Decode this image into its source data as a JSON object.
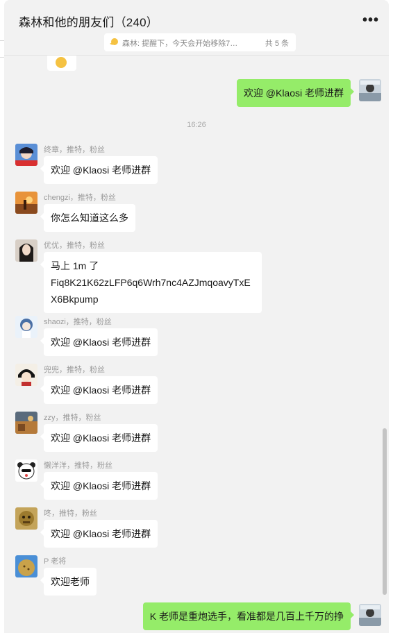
{
  "header": {
    "title": "森林和他的朋友们（240）",
    "more_label": "•••"
  },
  "pinned": {
    "text": "森林: 提醒下，今天会开始移除7…",
    "count": "共 5 条"
  },
  "timestamp": "16:26",
  "messages": [
    {
      "side": "self",
      "text": "欢迎 @Klaosi 老师进群"
    },
    {
      "side": "other",
      "sender": "终章，推特，粉丝",
      "text": "欢迎 @Klaosi 老师进群"
    },
    {
      "side": "other",
      "sender": "chengzi，推特，粉丝",
      "text": "你怎么知道这么多"
    },
    {
      "side": "other",
      "sender": "优优，推特，粉丝",
      "lines": [
        "马上 1m 了",
        "Fiq8K21K62zLFP6q6Wrh7nc4AZJmqoavyTxE",
        "X6Bkpump"
      ]
    },
    {
      "side": "other",
      "sender": "shaozi，推特，粉丝",
      "text": "欢迎 @Klaosi 老师进群"
    },
    {
      "side": "other",
      "sender": "兜兜，推特，粉丝",
      "text": "欢迎 @Klaosi 老师进群"
    },
    {
      "side": "other",
      "sender": "zzy，推特，粉丝",
      "text": "欢迎 @Klaosi 老师进群"
    },
    {
      "side": "other",
      "sender": "懒洋洋，推特，粉丝",
      "text": "欢迎 @Klaosi 老师进群"
    },
    {
      "side": "other",
      "sender": "咚，推特，粉丝",
      "text": "欢迎 @Klaosi 老师进群"
    },
    {
      "side": "other",
      "sender": "P 老将",
      "text": "欢迎老师"
    },
    {
      "side": "self",
      "text": "K 老师是重炮选手，看准都是几百上千万的挣"
    }
  ],
  "colors": {
    "self_bubble": "#95ec69",
    "other_bubble": "#ffffff",
    "background": "#f2f2f2"
  }
}
